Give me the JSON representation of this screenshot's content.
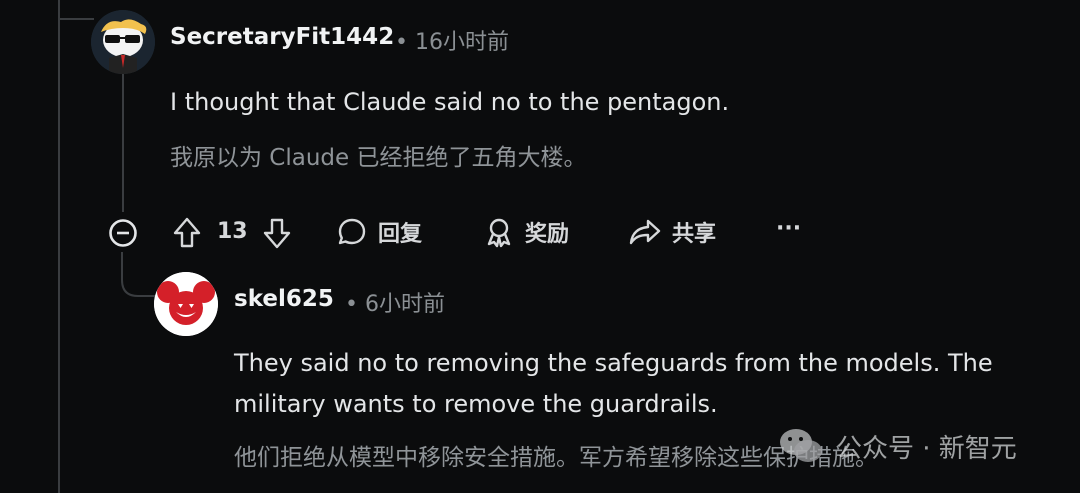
{
  "comments": [
    {
      "username": "SecretaryFit1442",
      "time": "• 16小时前",
      "text": "I thought that Claude said no to the pentagon.",
      "translation": "我原以为 Claude 已经拒绝了五角大楼。",
      "avatar_icon": "snoo-sunglasses-avatar"
    },
    {
      "username": "skel625",
      "time": "• 6小时前",
      "text_line1": "They said no to removing the safeguards from the models. The",
      "text_line2": "military wants to remove the guardrails.",
      "translation": "他们拒绝从模型中移除安全措施。军方希望移除这些保护措施。",
      "avatar_icon": "red-mouse-helmet-avatar"
    }
  ],
  "actions": {
    "vote_count": "13",
    "reply_label": "回复",
    "award_label": "奖励",
    "share_label": "共享",
    "more_label": "···"
  },
  "watermark": {
    "text": "公众号 · 新智元",
    "icon": "wechat-icon"
  },
  "colors": {
    "background": "#0b0c0d",
    "thread_line": "#3a3d40",
    "secondary_text": "#8b9094",
    "avatar_red": "#d42029"
  }
}
